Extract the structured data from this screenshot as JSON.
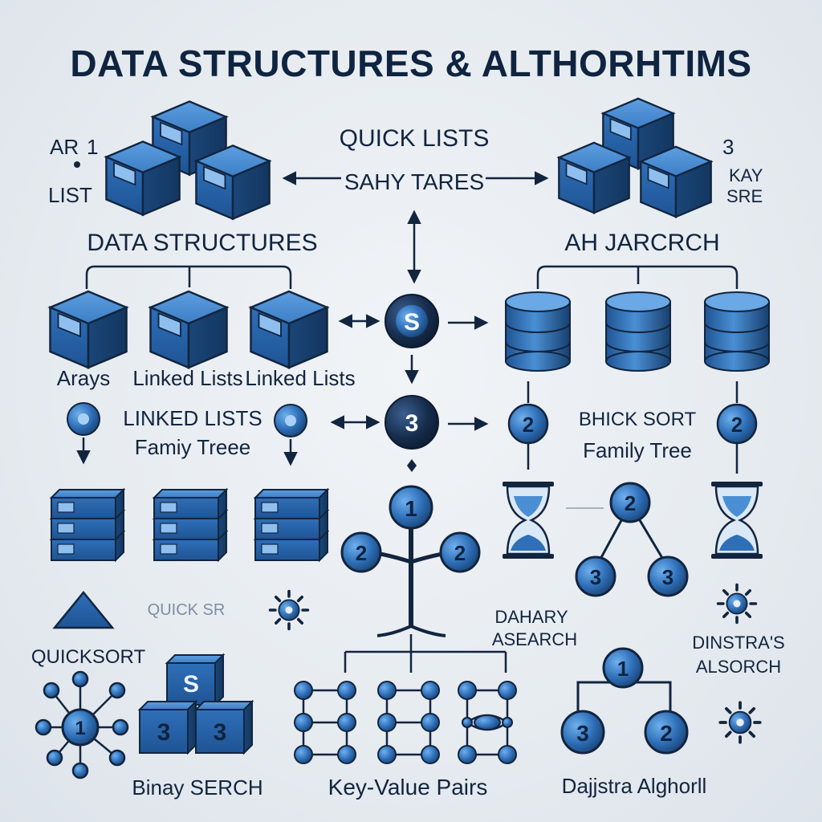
{
  "title": "DATA STRUCTURES & ALTHORHTIMS",
  "labels": {
    "top_left_a": "AR",
    "top_left_b": "1",
    "top_left_list": "LIST",
    "quick_lists": "QUICK LISTS",
    "sahy_tares": "SAHY TARES",
    "top_right_a": "3",
    "top_right_b": "KAY",
    "top_right_c": "SRE",
    "data_structures": "DATA STRUCTURES",
    "ah_jarcrch": "AH JARCRCH",
    "arrays": "Arays",
    "linked_lists_1": "Linked Lists",
    "linked_lists_2": "Linked Lists",
    "linked_lists_caps": "LINKED LISTS",
    "family_tree_left": "Famiy Treee",
    "bhick_sort": "BHICK SORT",
    "family_tree_right": "Family Tree",
    "quick_sr_faint": "QUICK SR",
    "dahary_asearch_1": "DAHARY",
    "dahary_asearch_2": "ASEARCH",
    "dinstras_1": "DINSTRA'S",
    "dinstras_2": "ALSORCH",
    "quicksort": "QUICKSORT",
    "binary_search": "Binay SERCH",
    "key_value_pairs": "Key-Value Pairs",
    "dajistra_algorithm": "Dajjstra Alghorll"
  },
  "nodes": {
    "hub_s": "S",
    "hub_3": "3",
    "tree_top": "1",
    "tree_left": "2",
    "tree_right": "2",
    "right_node_a": "2",
    "right_node_b": "2",
    "mid_tree_top": "2",
    "mid_tree_left": "3",
    "mid_tree_right": "3",
    "dij_top": "1",
    "dij_left": "3",
    "dij_right": "2",
    "star_center": "1",
    "cube_s": "S",
    "cube_3a": "3",
    "cube_3b": "3"
  },
  "colors": {
    "accent": "#2f6fb8",
    "dark_navy": "#12253f",
    "background": "#e9eef3"
  }
}
